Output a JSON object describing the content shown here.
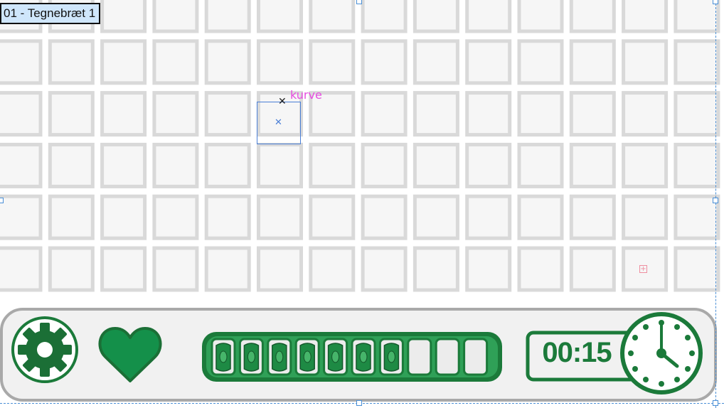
{
  "artboard": {
    "label": "01 - Tegnebræt 1"
  },
  "selection": {
    "path_label": "kurve"
  },
  "hud": {
    "energy": {
      "filled_cells": 7,
      "total_cells": 10
    },
    "timer": {
      "value": "00:15"
    }
  },
  "icons": {
    "settings": "gear-icon",
    "lives": "heart-icon",
    "money": "banknote-icon",
    "clock": "clock-icon"
  },
  "colors": {
    "tile_border": "#d9d9d9",
    "tile_fill": "#f6f6f6",
    "accent_green": "#1b7a3a",
    "heart_green": "#14904a",
    "selection_blue": "#4a7fd6",
    "label_magenta": "#e64de0"
  }
}
